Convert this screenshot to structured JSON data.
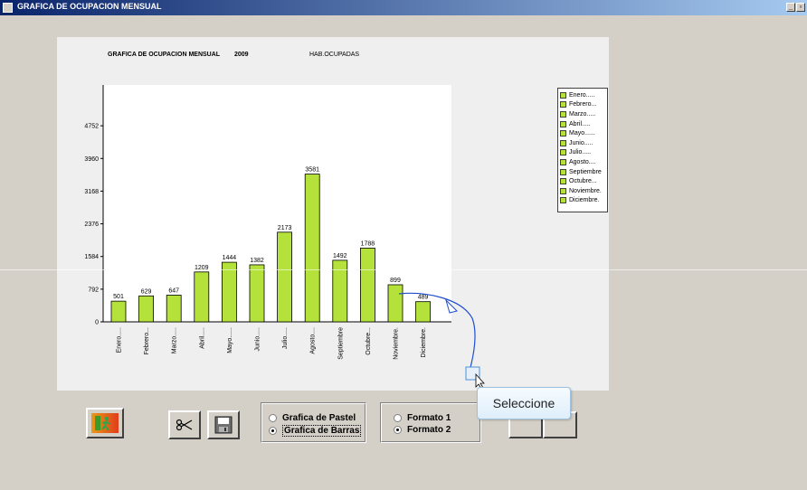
{
  "window": {
    "title": "GRAFICA DE OCUPACION MENSUAL",
    "minimize_label": "_",
    "restore_label": "▫"
  },
  "chart_data": {
    "type": "bar",
    "title": "GRAFICA DE OCUPACION MENSUAL",
    "year": "2009",
    "subtitle": "HAB.OCUPADAS",
    "categories": [
      "Enero.....",
      "Febrero...",
      "Marzo.....",
      "Abril.....",
      "Mayo......",
      "Junio.....",
      "Julio.....",
      "Agosto....",
      "Septiembre",
      "Octubre...",
      "Noviembre.",
      "Diciembre."
    ],
    "values": [
      501,
      629,
      647,
      1209,
      1444,
      1382,
      2173,
      3581,
      1492,
      1788,
      899,
      489
    ],
    "yticks": [
      0,
      792,
      1584,
      2376,
      3168,
      3960,
      4752
    ],
    "ylim": [
      0,
      5500
    ],
    "bar_color": "#b4e23a",
    "legend_position": "top-right",
    "grid": false
  },
  "legend": {
    "items": [
      "Enero.....",
      "Febrero...",
      "Marzo.....",
      "Abril.....",
      "Mayo......",
      "Junio.....",
      "Julio.....",
      "Agosto....",
      "Septiembre",
      "Octubre...",
      "Noviembre.",
      "Diciembre."
    ]
  },
  "controls": {
    "exit_icon": "exit-door-icon",
    "cut_icon": "scissors-icon",
    "save_icon": "floppy-disk-icon",
    "chart_type": {
      "options": [
        "Grafica de Pastel",
        "Grafica de Barras"
      ],
      "selected": "Grafica de Barras"
    },
    "format": {
      "options": [
        "Formato 1",
        "Formato 2"
      ],
      "selected": "Formato 2"
    }
  },
  "tooltip": {
    "text": "Seleccione"
  }
}
